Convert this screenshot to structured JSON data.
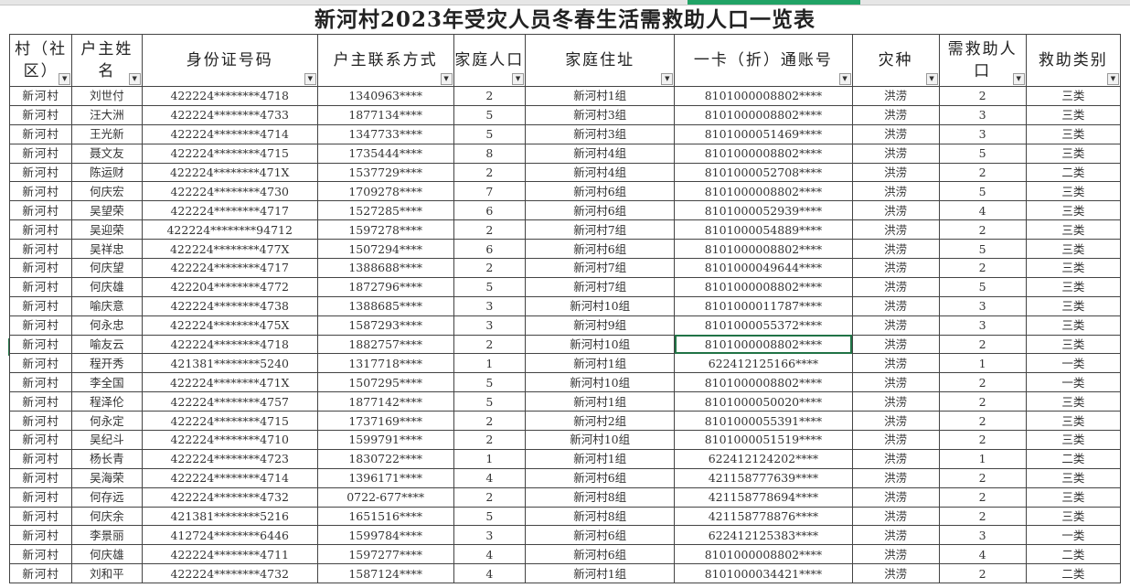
{
  "title": "新河村2023年受灾人员冬春生活需救助人口一览表",
  "headers": [
    {
      "label": "村（社区）",
      "w": 66
    },
    {
      "label": "户主姓名",
      "w": 74
    },
    {
      "label": "身份证号码",
      "w": 186
    },
    {
      "label": "户主联系方式",
      "w": 144
    },
    {
      "label": "家庭人口",
      "w": 76
    },
    {
      "label": "家庭住址",
      "w": 158
    },
    {
      "label": "一卡（折）通账号",
      "w": 188
    },
    {
      "label": "灾种",
      "w": 92
    },
    {
      "label": "需救助人口",
      "w": 92
    },
    {
      "label": "救助类别",
      "w": 100
    }
  ],
  "filter_icon": "dropdown-arrow-icon",
  "rows": [
    [
      "新河村",
      "刘世付",
      "422224********4718",
      "1340963****",
      "2",
      "新河村1组",
      "8101000008802****",
      "洪涝",
      "2",
      "三类"
    ],
    [
      "新河村",
      "汪大洲",
      "422224********4733",
      "1877134****",
      "5",
      "新河村3组",
      "8101000008802****",
      "洪涝",
      "3",
      "三类"
    ],
    [
      "新河村",
      "王光新",
      "422224********4714",
      "1347733****",
      "5",
      "新河村3组",
      "8101000051469****",
      "洪涝",
      "3",
      "三类"
    ],
    [
      "新河村",
      "聂文友",
      "422224********4715",
      "1735444****",
      "8",
      "新河村4组",
      "8101000008802****",
      "洪涝",
      "5",
      "三类"
    ],
    [
      "新河村",
      "陈运财",
      "422224********471X",
      "1537729****",
      "2",
      "新河村4组",
      "8101000052708****",
      "洪涝",
      "2",
      "二类"
    ],
    [
      "新河村",
      "何庆宏",
      "422224********4730",
      "1709278****",
      "7",
      "新河村6组",
      "8101000008802****",
      "洪涝",
      "5",
      "三类"
    ],
    [
      "新河村",
      "吴望荣",
      "422224********4717",
      "1527285****",
      "6",
      "新河村6组",
      "8101000052939****",
      "洪涝",
      "4",
      "三类"
    ],
    [
      "新河村",
      "吴迎荣",
      "422224********94712",
      "1597278****",
      "2",
      "新河村7组",
      "8101000054889****",
      "洪涝",
      "2",
      "三类"
    ],
    [
      "新河村",
      "吴祥忠",
      "422224********477X",
      "1507294****",
      "6",
      "新河村6组",
      "8101000008802****",
      "洪涝",
      "5",
      "三类"
    ],
    [
      "新河村",
      "何庆望",
      "422224********4717",
      "1388688****",
      "2",
      "新河村7组",
      "8101000049644****",
      "洪涝",
      "2",
      "三类"
    ],
    [
      "新河村",
      "何庆雄",
      "422204********4772",
      "1872796****",
      "5",
      "新河村7组",
      "8101000008802****",
      "洪涝",
      "5",
      "三类"
    ],
    [
      "新河村",
      "喻庆意",
      "422224********4738",
      "1388685****",
      "3",
      "新河村10组",
      "8101000011787****",
      "洪涝",
      "3",
      "三类"
    ],
    [
      "新河村",
      "何永忠",
      "422224********475X",
      "1587293****",
      "3",
      "新河村9组",
      "8101000055372****",
      "洪涝",
      "3",
      "三类"
    ],
    [
      "新河村",
      "喻友云",
      "422224********4718",
      "1882757****",
      "2",
      "新河村10组",
      "8101000008802****",
      "洪涝",
      "2",
      "三类"
    ],
    [
      "新河村",
      "程开秀",
      "421381********5240",
      "1317718****",
      "1",
      "新河村1组",
      "622412125166****",
      "洪涝",
      "1",
      "一类"
    ],
    [
      "新河村",
      "李全国",
      "422224********471X",
      "1507295****",
      "5",
      "新河村10组",
      "8101000008802****",
      "洪涝",
      "2",
      "一类"
    ],
    [
      "新河村",
      "程泽伦",
      "422224********4757",
      "1877142****",
      "5",
      "新河村1组",
      "8101000050020****",
      "洪涝",
      "2",
      "三类"
    ],
    [
      "新河村",
      "何永定",
      "422224********4715",
      "1737169****",
      "2",
      "新河村2组",
      "8101000055391****",
      "洪涝",
      "2",
      "三类"
    ],
    [
      "新河村",
      "吴纪斗",
      "422224********4710",
      "1599791****",
      "2",
      "新河村10组",
      "8101000051519****",
      "洪涝",
      "2",
      "三类"
    ],
    [
      "新河村",
      "杨长青",
      "422224********4723",
      "1830722****",
      "1",
      "新河村1组",
      "622412124202****",
      "洪涝",
      "1",
      "二类"
    ],
    [
      "新河村",
      "吴海荣",
      "422224********4714",
      "1396171****",
      "4",
      "新河村6组",
      "421158777639****",
      "洪涝",
      "2",
      "三类"
    ],
    [
      "新河村",
      "何存远",
      "422224********4732",
      "0722-677****",
      "2",
      "新河村8组",
      "421158778694****",
      "洪涝",
      "2",
      "三类"
    ],
    [
      "新河村",
      "何庆余",
      "421381********5216",
      "1651516****",
      "5",
      "新河村8组",
      "421158778876****",
      "洪涝",
      "2",
      "三类"
    ],
    [
      "新河村",
      "李景丽",
      "412724********6446",
      "1599784****",
      "3",
      "新河村6组",
      "622412125383****",
      "洪涝",
      "3",
      "一类"
    ],
    [
      "新河村",
      "何庆雄",
      "422224********4711",
      "1597277****",
      "4",
      "新河村6组",
      "8101000008802****",
      "洪涝",
      "4",
      "二类"
    ],
    [
      "新河村",
      "刘和平",
      "422224********4732",
      "1587124****",
      "4",
      "新河村1组",
      "8101000034421****",
      "洪涝",
      "2",
      "二类"
    ]
  ]
}
